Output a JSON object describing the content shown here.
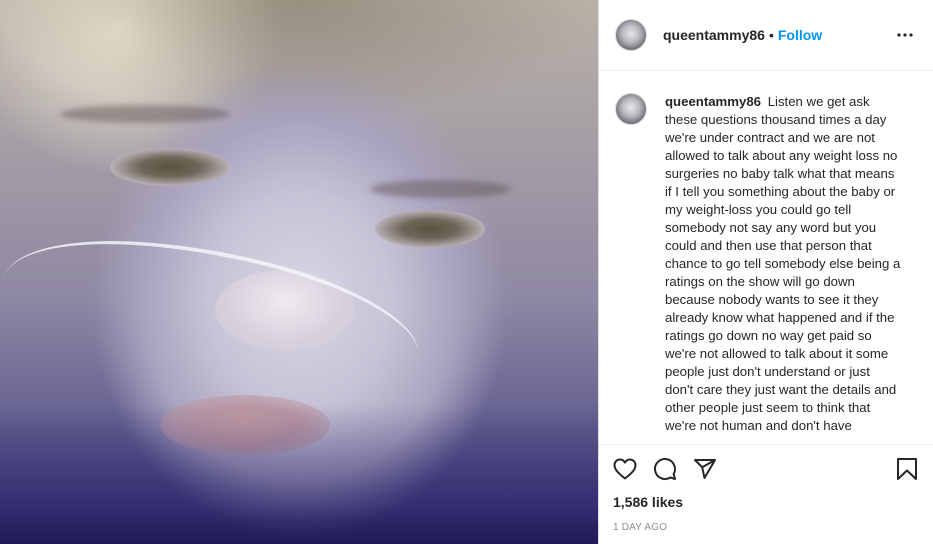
{
  "post": {
    "username": "queentammy86",
    "separator": "•",
    "follow_label": "Follow",
    "caption_user": "queentammy86",
    "caption_text": "Listen we get ask these questions thousand times a day we're under contract and we are not allowed to talk about any weight loss no surgeries no baby talk what that means if I tell you something about the baby or my weight-loss you could go tell somebody not say any word but you could and then use that person that chance to go tell somebody else being a ratings on the show will go down because nobody wants to see it they already know what happened and if the ratings go down no way get paid so we're not allowed to talk about it some people just don't understand or just don't care they just want the details and other people just seem to think that we're not human and don't have",
    "likes": "1,586 likes",
    "time": "1 DAY AGO"
  },
  "icons": {
    "more": "more-options-icon",
    "like": "heart-icon",
    "comment": "comment-icon",
    "share": "paper-plane-icon",
    "save": "bookmark-icon"
  }
}
